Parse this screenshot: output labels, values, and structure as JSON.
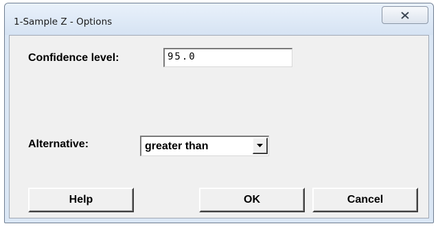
{
  "window": {
    "title": "1-Sample Z - Options"
  },
  "form": {
    "confidence_label": "Confidence level:",
    "confidence_value": "95.0",
    "alternative_label": "Alternative:",
    "alternative_value": "greater than"
  },
  "buttons": {
    "help": "Help",
    "ok": "OK",
    "cancel": "Cancel"
  },
  "icons": {
    "close": "close-icon",
    "dropdown": "chevron-down-icon"
  },
  "colors": {
    "titlebar": "#dbe7f5",
    "client": "#f0f0f0"
  }
}
